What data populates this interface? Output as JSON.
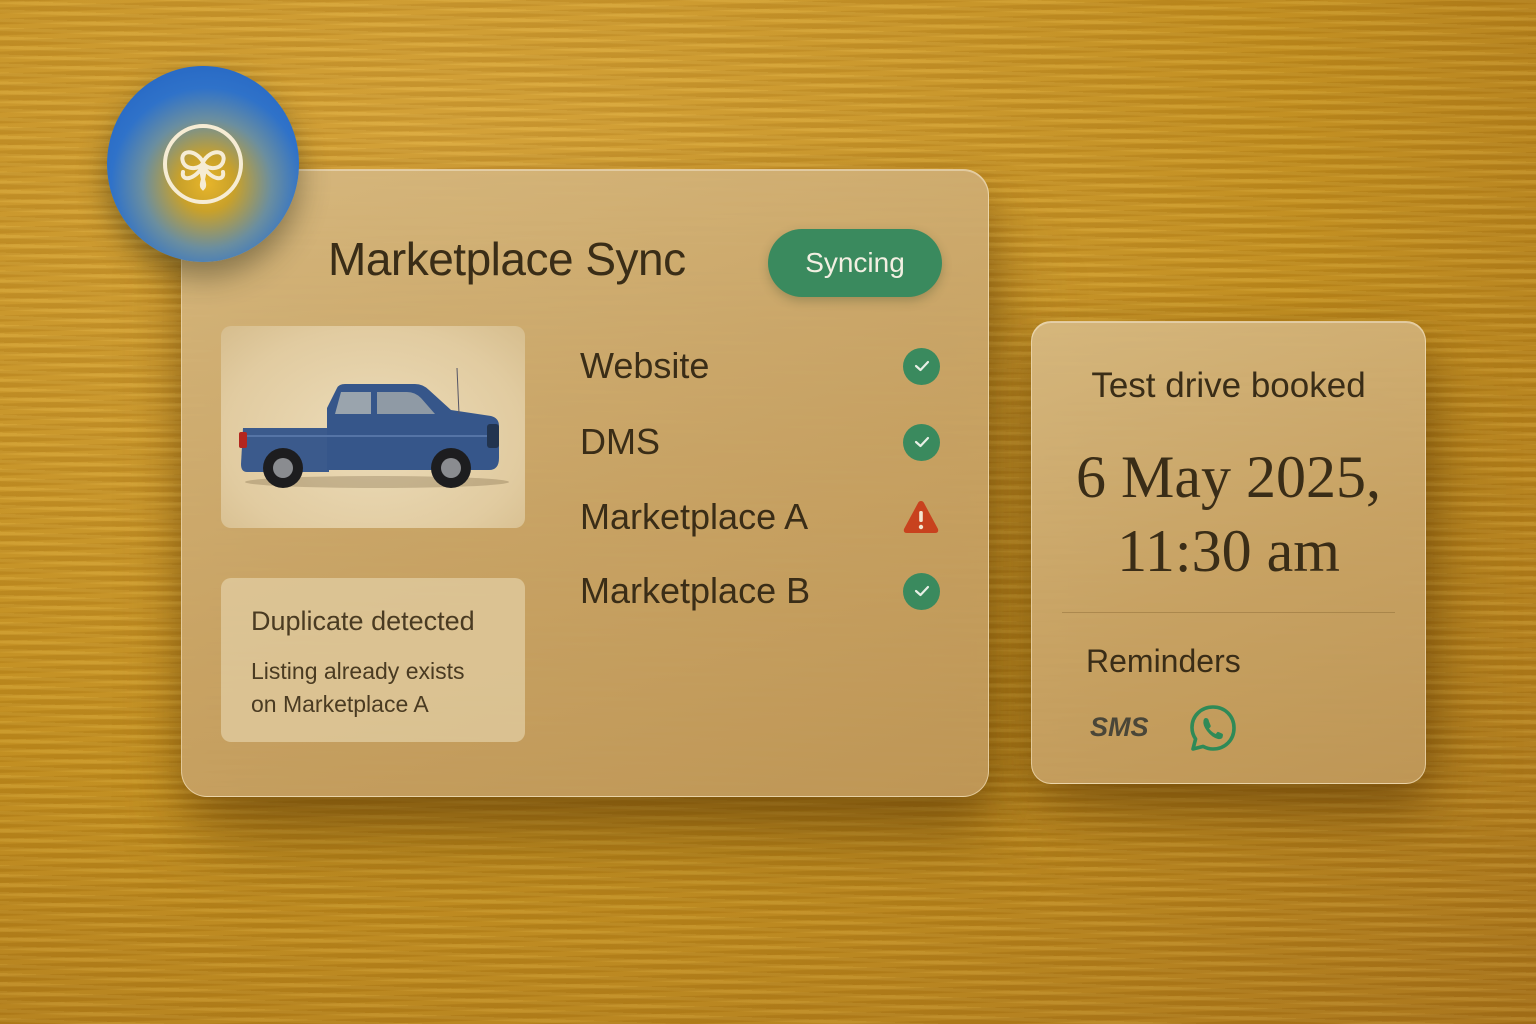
{
  "sync_card": {
    "title": "Marketplace Sync",
    "status_badge": "Syncing",
    "listings": [
      {
        "label": "Website",
        "status": "ok",
        "icon": "check-icon"
      },
      {
        "label": "DMS",
        "status": "ok",
        "icon": "check-icon"
      },
      {
        "label": "Marketplace A",
        "status": "warning",
        "icon": "warning-icon"
      },
      {
        "label": "Marketplace B",
        "status": "ok",
        "icon": "check-icon"
      }
    ],
    "alert": {
      "title": "Duplicate detected",
      "message_line1": "Listing already exists",
      "message_line2": "on Marketplace A"
    },
    "vehicle_image": "blue-pickup-truck"
  },
  "booking_card": {
    "title": "Test drive booked",
    "date_line": "6 May 2025,",
    "time_line": "11:30 am",
    "reminders_title": "Reminders",
    "reminder_channels": [
      {
        "label": "SMS"
      },
      {
        "icon": "whatsapp-icon"
      }
    ]
  },
  "colors": {
    "accent_green": "#3a8a5e",
    "warning_orange": "#c8421e",
    "text_dark": "#3a2d17"
  }
}
